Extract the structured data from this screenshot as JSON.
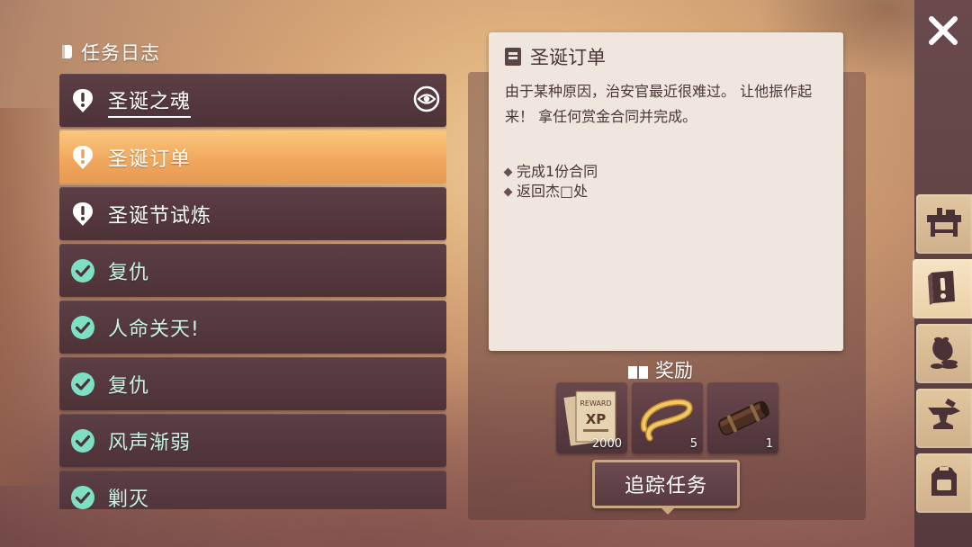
{
  "journal": {
    "title": "任务日志",
    "quests": [
      {
        "label": "圣诞之魂",
        "status": "active",
        "tracked": true
      },
      {
        "label": "圣诞订单",
        "status": "active",
        "selected": true
      },
      {
        "label": "圣诞节试炼",
        "status": "active"
      },
      {
        "label": "复仇",
        "status": "completed"
      },
      {
        "label": "人命关天!",
        "status": "completed"
      },
      {
        "label": "复仇",
        "status": "completed"
      },
      {
        "label": "风声渐弱",
        "status": "completed"
      },
      {
        "label": "剿灭",
        "status": "completed"
      }
    ]
  },
  "detail": {
    "title": "圣诞订单",
    "description": "由于某种原因，治安官最近很难过。 让他振作起来！ 拿任何赏金合同并完成。",
    "objectives": [
      "完成1份合同",
      "返回杰□处"
    ]
  },
  "rewards": {
    "title": "奖励",
    "items": [
      {
        "icon": "xp-reward-poster-icon",
        "count": "2000"
      },
      {
        "icon": "gold-beads-necklace-icon",
        "count": "5"
      },
      {
        "icon": "leather-tube-icon",
        "count": "1"
      }
    ]
  },
  "track_button": {
    "label": "追踪任务"
  },
  "sidebar": {
    "tabs": [
      "workbench-icon",
      "quest-journal-icon",
      "loot-bag-icon",
      "anvil-icon",
      "backpack-icon"
    ],
    "active_tab": "quest-journal-icon"
  },
  "colors": {
    "selected_row": "#f0a85d",
    "row": "#4d3238",
    "completed_check": "#7de0c4",
    "panel": "#efe6de"
  }
}
